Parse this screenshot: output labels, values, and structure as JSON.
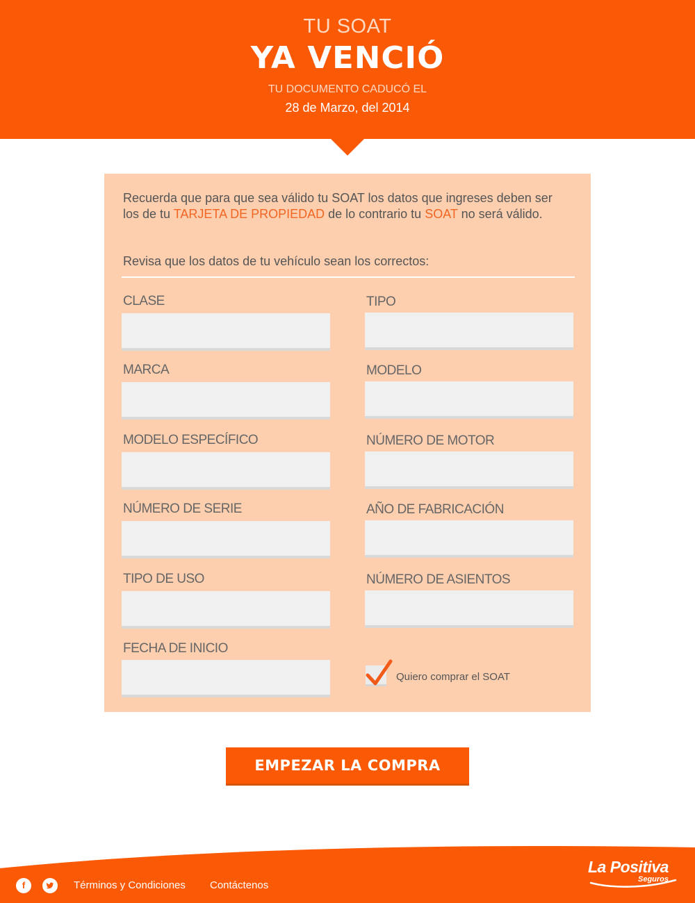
{
  "header": {
    "line1": "TU SOAT",
    "headline": "YA VENCIÓ",
    "line3": "TU DOCUMENTO CADUCÓ EL",
    "date": "28 de Marzo, del 2014"
  },
  "intro": {
    "text_a": "Recuerda que para que sea válido tu SOAT los datos que ingreses deben ser los de tu ",
    "highlight_1": "TARJETA DE PROPIEDAD",
    "text_b": " de lo contrario tu ",
    "highlight_2": "SOAT",
    "text_c": " no será válido.",
    "review": "Revisa que los datos de tu vehículo sean los correctos:"
  },
  "fields": {
    "clase": {
      "label": "CLASE",
      "value": ""
    },
    "tipo": {
      "label": "TIPO",
      "value": ""
    },
    "marca": {
      "label": "MARCA",
      "value": ""
    },
    "modelo": {
      "label": "MODELO",
      "value": ""
    },
    "modelo_especifico": {
      "label": "MODELO ESPECÍFICO",
      "value": ""
    },
    "numero_motor": {
      "label": "NÚMERO DE MOTOR",
      "value": ""
    },
    "numero_serie": {
      "label": "NÚMERO DE SERIE",
      "value": ""
    },
    "anio_fabricacion": {
      "label": "AÑO DE FABRICACIÓN",
      "value": ""
    },
    "tipo_uso": {
      "label": "TIPO DE USO",
      "value": ""
    },
    "numero_asientos": {
      "label": "NÚMERO DE ASIENTOS",
      "value": ""
    },
    "fecha_inicio": {
      "label": "FECHA DE INICIO",
      "value": ""
    }
  },
  "checkbox": {
    "label": "Quiero comprar el SOAT",
    "checked": true
  },
  "cta": {
    "label": "EMPEZAR LA COMPRA"
  },
  "footer": {
    "links": [
      "Términos y Condiciones",
      "Contáctenos"
    ],
    "social_icons": [
      "facebook-icon",
      "twitter-icon"
    ],
    "logo_name": "La Positiva",
    "logo_sub": "Seguros"
  },
  "colors": {
    "brand": "#fa5a06",
    "panel": "#fdcfaf",
    "highlight": "#f26522",
    "field": "#f0f0f0"
  }
}
